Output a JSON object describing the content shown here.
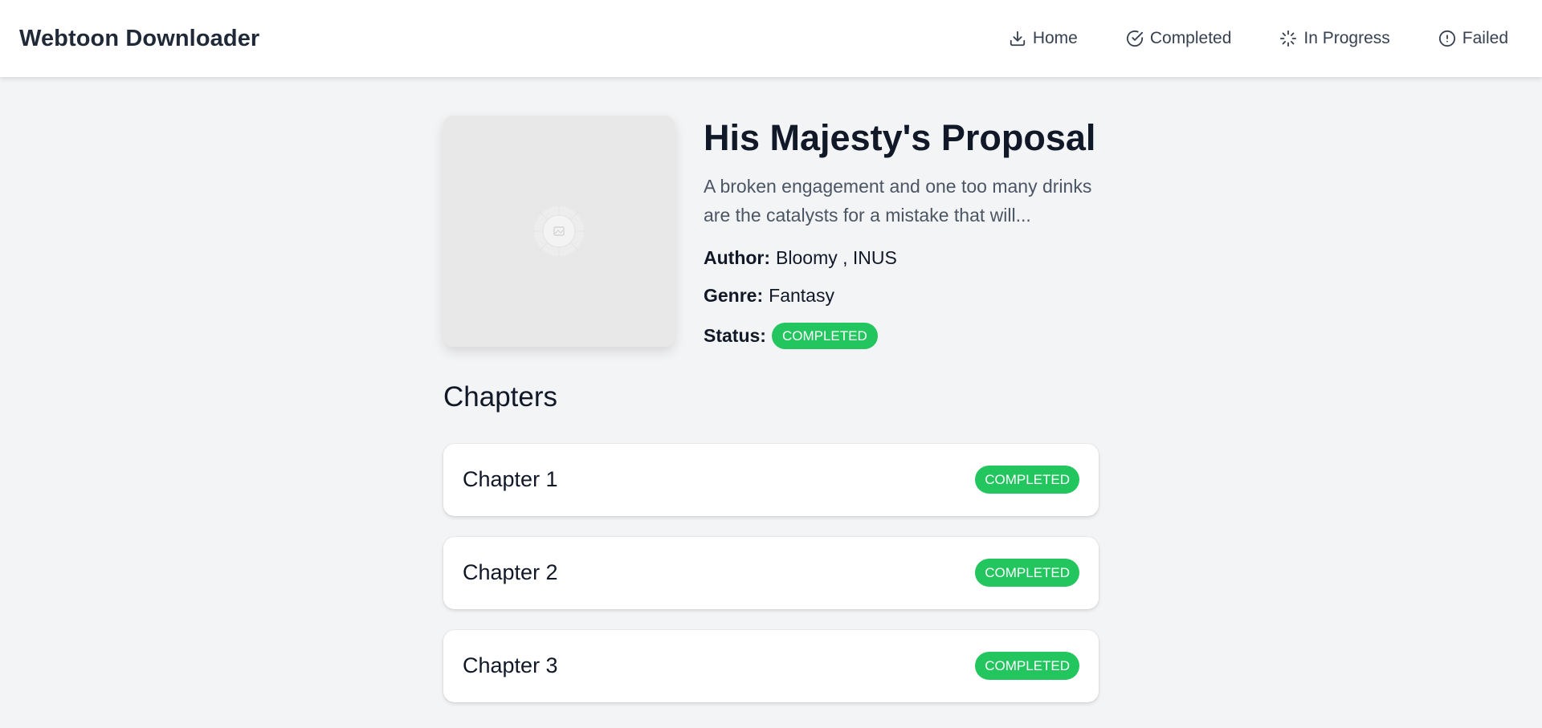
{
  "header": {
    "app_title": "Webtoon Downloader",
    "nav": [
      {
        "label": "Home",
        "icon": "download-icon"
      },
      {
        "label": "Completed",
        "icon": "check-circle-icon"
      },
      {
        "label": "In Progress",
        "icon": "loader-icon"
      },
      {
        "label": "Failed",
        "icon": "alert-circle-icon"
      }
    ]
  },
  "series": {
    "title": "His Majesty's Proposal",
    "description": "A broken engagement and one too many drinks are the catalysts for a mistake that will...",
    "author_label": "Author:",
    "author": "Bloomy , INUS",
    "genre_label": "Genre:",
    "genre": "Fantasy",
    "status_label": "Status:",
    "status": "COMPLETED",
    "cover_icon": "image-placeholder-icon"
  },
  "chapters": {
    "heading": "Chapters",
    "items": [
      {
        "title": "Chapter 1",
        "status": "COMPLETED"
      },
      {
        "title": "Chapter 2",
        "status": "COMPLETED"
      },
      {
        "title": "Chapter 3",
        "status": "COMPLETED"
      }
    ]
  },
  "colors": {
    "accent_success": "#22c55e",
    "page_background": "#f3f4f6",
    "header_background": "#ffffff"
  }
}
